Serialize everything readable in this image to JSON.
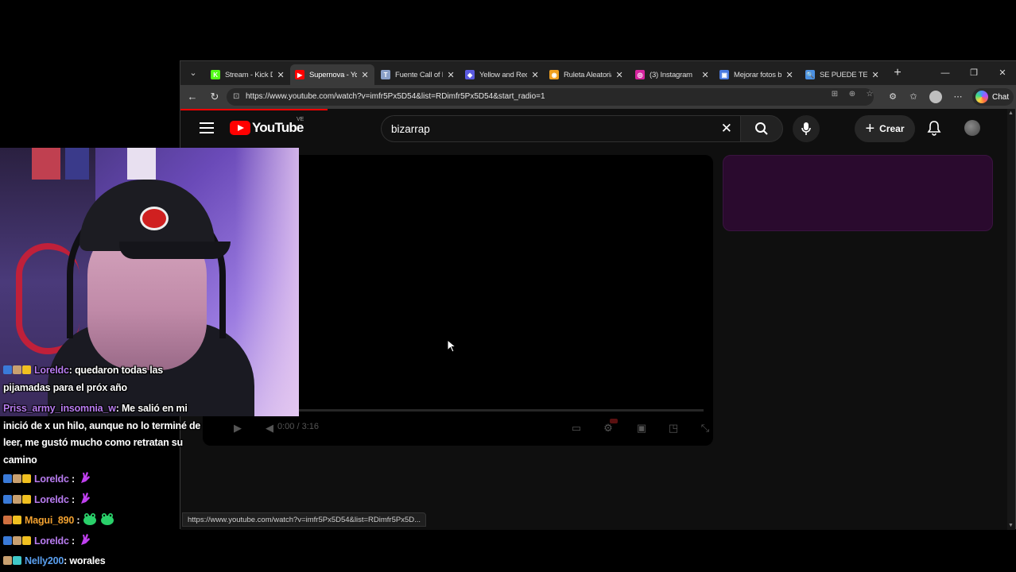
{
  "browser": {
    "tabs": [
      {
        "label": "Stream - Kick D",
        "favicon_color": "#53fc18",
        "favicon_glyph": "K",
        "active": false
      },
      {
        "label": "Supernova - Yo",
        "favicon_color": "#ff0000",
        "favicon_glyph": "▶",
        "active": true
      },
      {
        "label": "Fuente Call of D",
        "favicon_color": "#8aa0c8",
        "favicon_glyph": "T",
        "active": false
      },
      {
        "label": "Yellow and Red",
        "favicon_color": "#5a5adf",
        "favicon_glyph": "◆",
        "active": false
      },
      {
        "label": "Ruleta Aleatoria",
        "favicon_color": "#f0a020",
        "favicon_glyph": "◉",
        "active": false
      },
      {
        "label": "(3) Instagram",
        "favicon_color": "#d6249f",
        "favicon_glyph": "◎",
        "active": false
      },
      {
        "label": "Mejorar fotos b",
        "favicon_color": "#4a7adf",
        "favicon_glyph": "▣",
        "active": false
      },
      {
        "label": "SE PUEDE TENE",
        "favicon_color": "#4a90e2",
        "favicon_glyph": "🔍",
        "active": false
      }
    ],
    "url": "https://www.youtube.com/watch?v=imfr5Px5D54&list=RDimfr5Px5D54&start_radio=1",
    "chat_label": "Chat",
    "status_url": "https://www.youtube.com/watch?v=imfr5Px5D54&list=RDimfr5Px5D..."
  },
  "youtube": {
    "logo_text": "YouTube",
    "country_code": "VE",
    "search_value": "bizarrap",
    "create_label": "Crear",
    "time_display": "0:00 / 3:16"
  },
  "chat": {
    "messages": [
      {
        "user": "Loreldc",
        "user_color": "#b87cf0",
        "text": ": quedaron todas las pijamadas para el próx año",
        "badges": [
          "#3a7ad8",
          "#c8a070",
          "#f0c020"
        ],
        "emotes": 0
      },
      {
        "user": "Priss_army_insomnia_w",
        "user_color": "#b87cf0",
        "text": ": Me salió en mi inició de x un hilo, aunque no lo terminé de leer, me gustó mucho como retratan su camino",
        "badges": [],
        "emotes": 0
      },
      {
        "user": "Loreldc",
        "user_color": "#b87cf0",
        "text": " :",
        "badges": [
          "#3a7ad8",
          "#c8a070",
          "#f0c020"
        ],
        "emotes": 1,
        "emote_type": "purple-hand"
      },
      {
        "user": "Loreldc",
        "user_color": "#b87cf0",
        "text": " :",
        "badges": [
          "#3a7ad8",
          "#c8a070",
          "#f0c020"
        ],
        "emotes": 1,
        "emote_type": "purple-hand"
      },
      {
        "user": "Magui_890",
        "user_color": "#f0a030",
        "text": " :",
        "badges": [
          "#d07040",
          "#f0c020"
        ],
        "emotes": 2,
        "emote_type": "green-frog"
      },
      {
        "user": "Loreldc",
        "user_color": "#b87cf0",
        "text": " :",
        "badges": [
          "#3a7ad8",
          "#c8a070",
          "#f0c020"
        ],
        "emotes": 1,
        "emote_type": "purple-hand"
      },
      {
        "user": "Nelly200",
        "user_color": "#5aa0f0",
        "text": ": worales",
        "badges": [
          "#c8a070",
          "#40c8c8"
        ],
        "emotes": 0
      }
    ]
  }
}
